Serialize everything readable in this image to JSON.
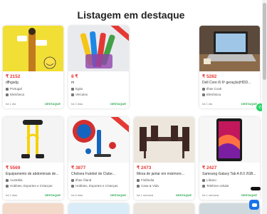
{
  "section_title": "Listagem em destaque",
  "listings": [
    {
      "price": "₹ 2152",
      "name": "dfhgsdg",
      "location": "Portugal",
      "category": "Eletrônica",
      "age": "há 1 dia",
      "badge": "DESTAQUE",
      "sale_ribbon": false
    },
    {
      "price": "8 ₹",
      "name": "m",
      "location": "Egito",
      "category": "Veículos",
      "age": "há 2 dias",
      "badge": "DESTAQUE",
      "sale_ribbon": true
    },
    {
      "price": "",
      "name": "",
      "location": "",
      "category": "",
      "age": "",
      "badge": "",
      "sale_ribbon": false
    },
    {
      "price": "₹ 5282",
      "name": "Dell Core i5 6ª geração(HDD...",
      "location": "Ilhas Cook",
      "category": "Eletrônica",
      "age": "há 1 dia",
      "badge": "DESTAQUE",
      "sale_ribbon": false
    },
    {
      "price": "₹ 5569",
      "name": "Equipamento de abdominais de...",
      "location": "Austrália",
      "category": "Hobbies, Esportes e Crianças",
      "age": "há 2 dias",
      "badge": "DESTAQUE",
      "sale_ribbon": false
    },
    {
      "price": "₹ 3877",
      "name": "Chelsea Futebol de Clube...",
      "location": "Ilhas Åland",
      "category": "Hobbies, Esportes e Crianças",
      "age": "há 6 dias",
      "badge": "DESTAQUE",
      "sale_ribbon": true
    },
    {
      "price": "₹ 2473",
      "name": "Mesa de jantar em mármore...",
      "location": "Finlândia",
      "category": "Casa & Vida",
      "age": "há 1 semana",
      "badge": "DESTAQUE",
      "sale_ribbon": false
    },
    {
      "price": "₹ 2427",
      "name": "Samsung Galaxy Tab A 8.0 2GB...",
      "location": "Líbano",
      "category": "Telefone celular",
      "age": "há 1 semana",
      "badge": "DESTAQUE",
      "sale_ribbon": false
    }
  ],
  "colors": {
    "price": "#e53935",
    "featured": "#22a447",
    "chat": "#1a73e8",
    "whatsapp": "#25d366"
  },
  "icons": {
    "whatsapp": "whatsapp-icon",
    "chat": "chat-icon",
    "location": "location-pin-icon",
    "category": "category-icon"
  }
}
